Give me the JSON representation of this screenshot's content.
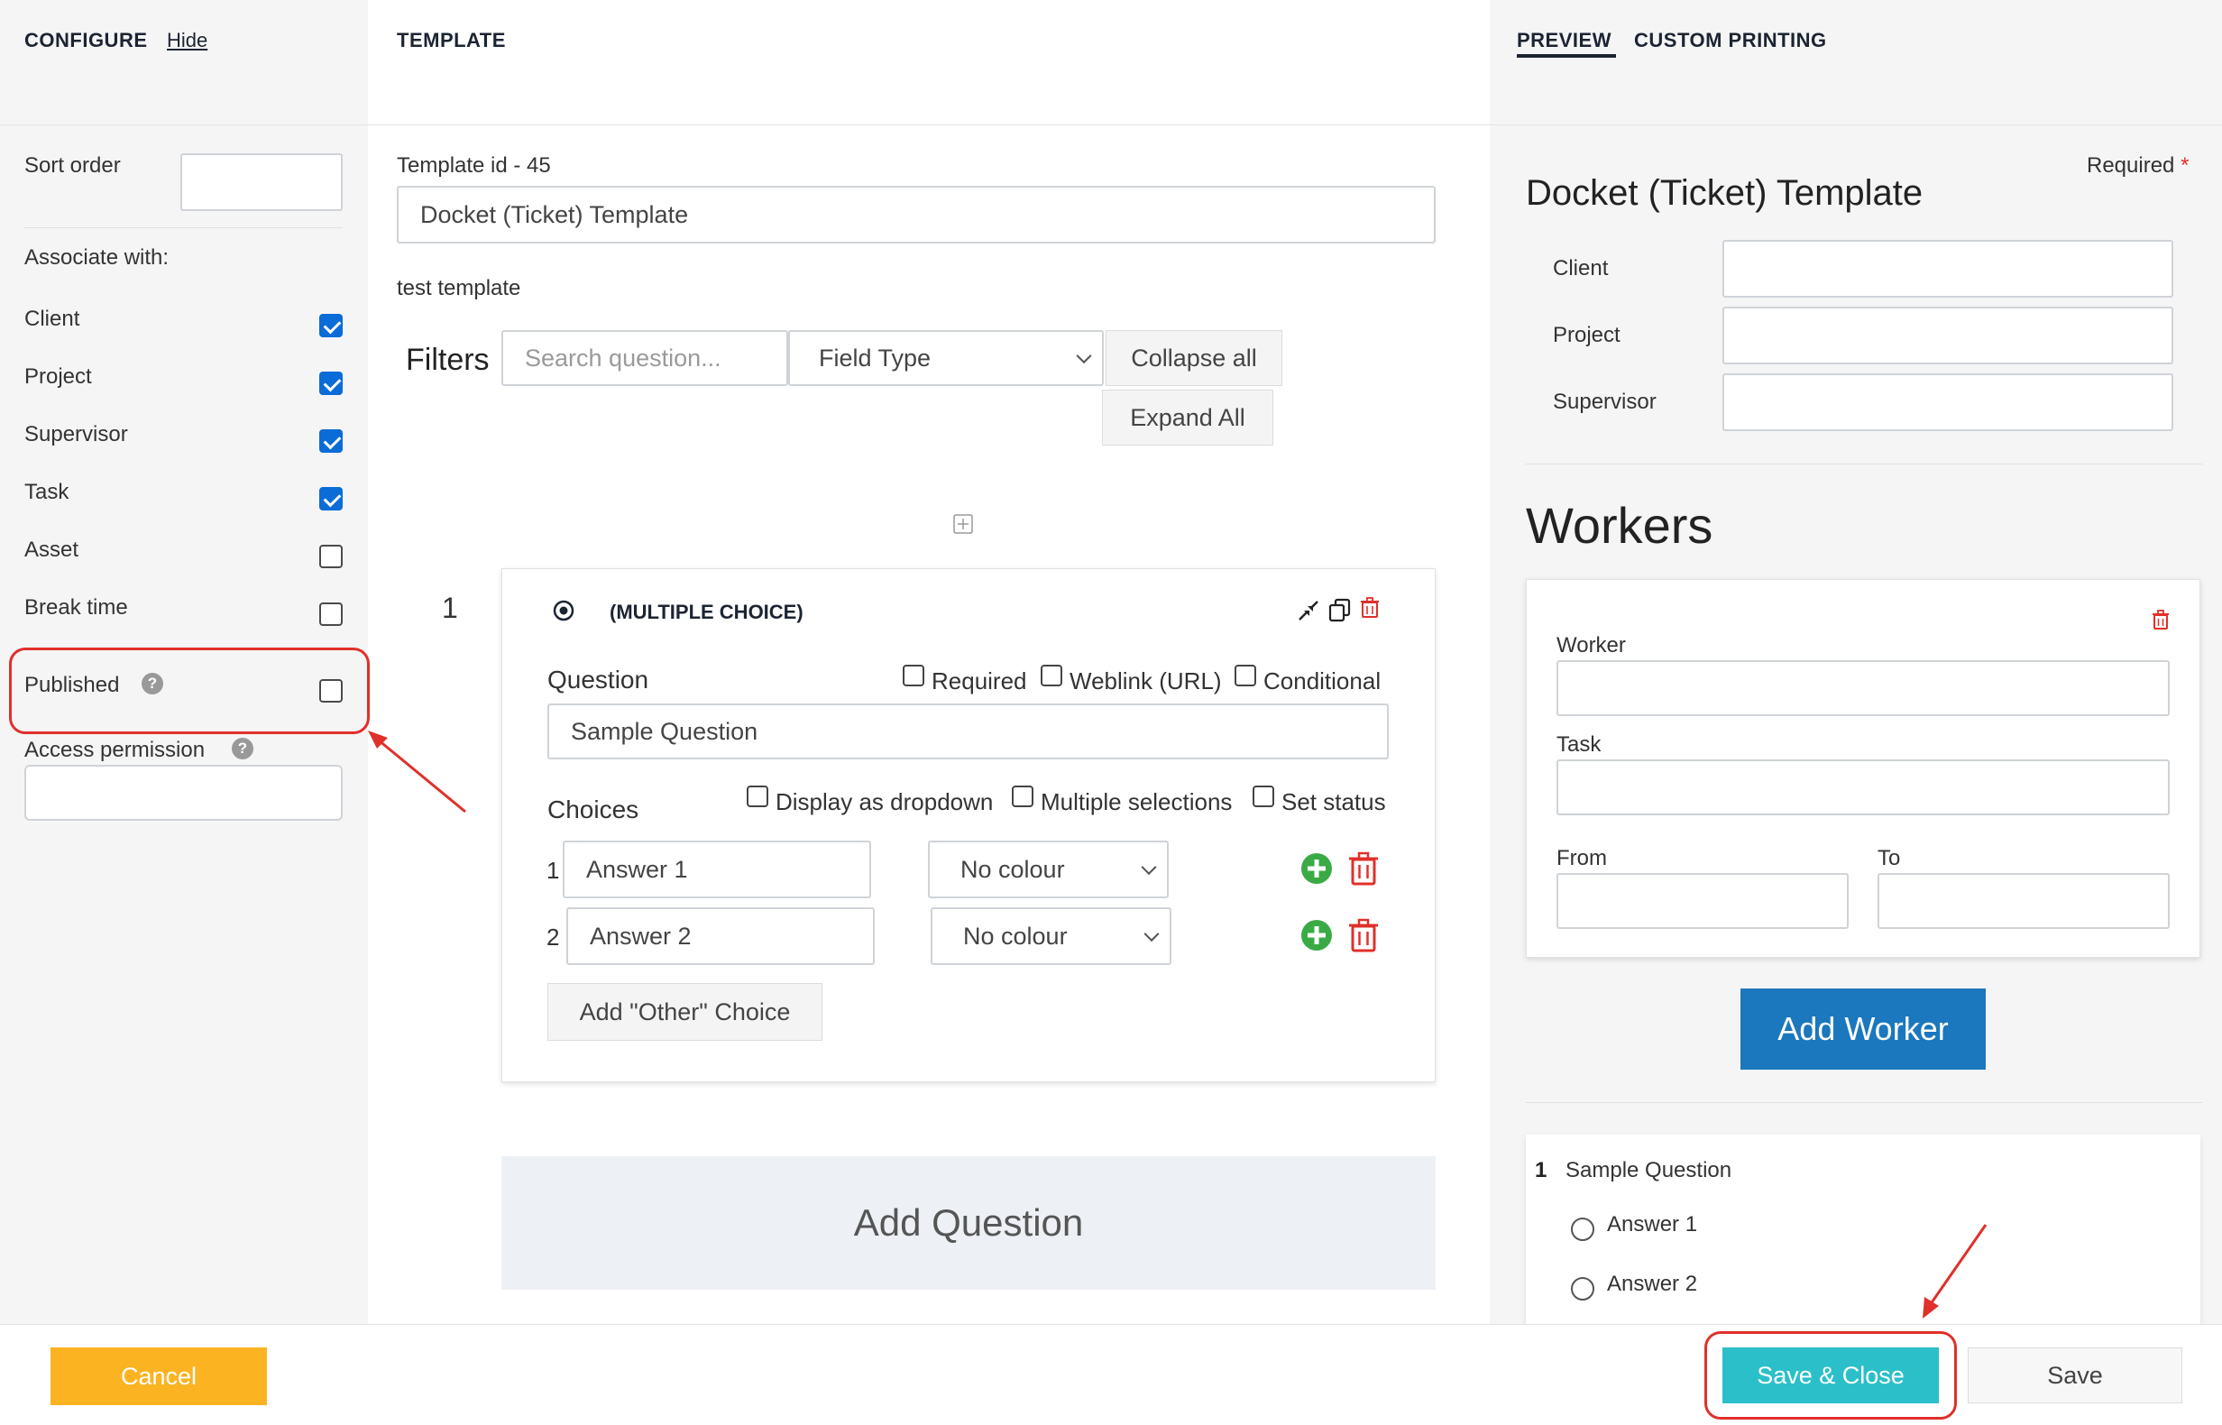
{
  "configure": {
    "title": "CONFIGURE",
    "hide": "Hide",
    "sort_order_label": "Sort order",
    "sort_order_value": "",
    "associate_label": "Associate with:",
    "items": [
      {
        "label": "Client",
        "checked": true
      },
      {
        "label": "Project",
        "checked": true
      },
      {
        "label": "Supervisor",
        "checked": true
      },
      {
        "label": "Task",
        "checked": true
      },
      {
        "label": "Asset",
        "checked": false
      },
      {
        "label": "Break time",
        "checked": false
      }
    ],
    "published_label": "Published",
    "published_checked": false,
    "access_permission_label": "Access permission",
    "access_permission_value": ""
  },
  "template": {
    "title": "TEMPLATE",
    "id_label": "Template id - 45",
    "name_value": "Docket (Ticket) Template",
    "description": "test template",
    "filters_label": "Filters",
    "search_placeholder": "Search question...",
    "field_type": "Field Type",
    "collapse_all": "Collapse all",
    "expand_all": "Expand All",
    "question_number": "1",
    "question_type": "(MULTIPLE CHOICE)",
    "question_label": "Question",
    "required_label": "Required",
    "weblink_label": "Weblink (URL)",
    "conditional_label": "Conditional",
    "question_value": "Sample Question",
    "choices_label": "Choices",
    "display_dropdown_label": "Display as dropdown",
    "multiple_selections_label": "Multiple selections",
    "set_status_label": "Set status",
    "choices": [
      {
        "num": "1",
        "value": "Answer 1",
        "colour": "No colour"
      },
      {
        "num": "2",
        "value": "Answer 2",
        "colour": "No colour"
      }
    ],
    "add_other": "Add \"Other\" Choice",
    "add_question": "Add Question"
  },
  "preview": {
    "tab_preview": "PREVIEW",
    "tab_custom": "CUSTOM PRINTING",
    "required_label": "Required",
    "required_star": "*",
    "title": "Docket (Ticket) Template",
    "fields": [
      "Client",
      "Project",
      "Supervisor"
    ],
    "workers_title": "Workers",
    "worker_label": "Worker",
    "task_label": "Task",
    "from_label": "From",
    "to_label": "To",
    "add_worker": "Add Worker",
    "q_number": "1",
    "q_text": "Sample Question",
    "answers": [
      "Answer 1",
      "Answer 2"
    ]
  },
  "footer": {
    "cancel": "Cancel",
    "save_close": "Save & Close",
    "save": "Save"
  },
  "colors": {
    "cancel_bg": "#fbb322",
    "save_close_bg": "#2bbfc9",
    "add_worker_bg": "#1b77be",
    "checkbox_on": "#0a6cd6",
    "annotation_red": "#e0302a"
  }
}
